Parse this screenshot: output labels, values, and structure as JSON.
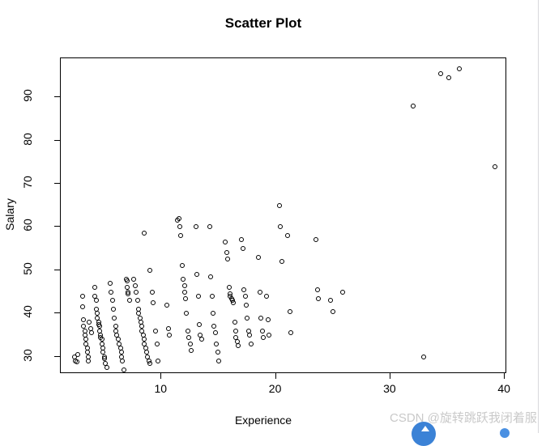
{
  "chart_data": {
    "type": "scatter",
    "title": "Scatter Plot",
    "xlabel": "Experience",
    "ylabel": "Salary",
    "xlim": [
      1.2,
      40.2
    ],
    "ylim": [
      26.0,
      99.0
    ],
    "xticks": [
      10,
      20,
      30,
      40
    ],
    "yticks": [
      30,
      40,
      50,
      60,
      70,
      80,
      90
    ],
    "grid": false,
    "legend": null,
    "marker": "open-circle",
    "marker_color": "#000000",
    "points": [
      [
        2.4,
        30.0
      ],
      [
        2.5,
        29.0
      ],
      [
        2.6,
        28.8
      ],
      [
        2.7,
        30.5
      ],
      [
        3.1,
        44.0
      ],
      [
        3.1,
        41.5
      ],
      [
        3.2,
        38.5
      ],
      [
        3.2,
        37.0
      ],
      [
        3.3,
        36.0
      ],
      [
        3.3,
        35.0
      ],
      [
        3.4,
        34.0
      ],
      [
        3.4,
        33.0
      ],
      [
        3.5,
        32.0
      ],
      [
        3.5,
        31.0
      ],
      [
        3.6,
        30.0
      ],
      [
        3.6,
        29.0
      ],
      [
        3.7,
        38.0
      ],
      [
        3.8,
        36.5
      ],
      [
        3.9,
        35.5
      ],
      [
        4.2,
        46.0
      ],
      [
        4.2,
        44.0
      ],
      [
        4.3,
        43.0
      ],
      [
        4.3,
        41.0
      ],
      [
        4.4,
        40.0
      ],
      [
        4.4,
        39.0
      ],
      [
        4.5,
        38.0
      ],
      [
        4.5,
        37.5
      ],
      [
        4.6,
        37.0
      ],
      [
        4.6,
        36.0
      ],
      [
        4.7,
        35.0
      ],
      [
        4.7,
        34.5
      ],
      [
        4.8,
        34.0
      ],
      [
        4.8,
        33.0
      ],
      [
        4.9,
        32.0
      ],
      [
        4.9,
        31.0
      ],
      [
        5.0,
        30.0
      ],
      [
        5.0,
        29.5
      ],
      [
        5.1,
        28.5
      ],
      [
        5.2,
        27.5
      ],
      [
        5.5,
        47.0
      ],
      [
        5.6,
        45.0
      ],
      [
        5.7,
        43.0
      ],
      [
        5.8,
        41.0
      ],
      [
        5.9,
        39.0
      ],
      [
        6.0,
        37.0
      ],
      [
        6.0,
        36.0
      ],
      [
        6.1,
        35.0
      ],
      [
        6.2,
        34.0
      ],
      [
        6.3,
        33.0
      ],
      [
        6.4,
        32.0
      ],
      [
        6.5,
        31.0
      ],
      [
        6.5,
        30.0
      ],
      [
        6.6,
        29.0
      ],
      [
        6.7,
        27.0
      ],
      [
        6.9,
        48.0
      ],
      [
        7.0,
        47.5
      ],
      [
        7.0,
        46.0
      ],
      [
        7.1,
        45.0
      ],
      [
        7.1,
        44.5
      ],
      [
        7.2,
        43.0
      ],
      [
        7.6,
        48.0
      ],
      [
        7.7,
        46.5
      ],
      [
        7.8,
        45.0
      ],
      [
        7.9,
        43.0
      ],
      [
        8.0,
        41.0
      ],
      [
        8.0,
        40.0
      ],
      [
        8.1,
        39.0
      ],
      [
        8.2,
        38.0
      ],
      [
        8.3,
        37.0
      ],
      [
        8.3,
        36.0
      ],
      [
        8.4,
        35.0
      ],
      [
        8.5,
        34.0
      ],
      [
        8.5,
        33.0
      ],
      [
        8.6,
        32.0
      ],
      [
        8.7,
        31.0
      ],
      [
        8.8,
        30.0
      ],
      [
        8.9,
        29.0
      ],
      [
        9.0,
        28.5
      ],
      [
        8.5,
        58.5
      ],
      [
        9.0,
        50.0
      ],
      [
        9.2,
        45.0
      ],
      [
        9.3,
        42.5
      ],
      [
        9.5,
        36.0
      ],
      [
        9.6,
        33.0
      ],
      [
        9.7,
        29.0
      ],
      [
        10.5,
        42.0
      ],
      [
        10.6,
        36.5
      ],
      [
        10.7,
        35.0
      ],
      [
        11.4,
        61.5
      ],
      [
        11.5,
        62.0
      ],
      [
        11.6,
        60.0
      ],
      [
        11.7,
        58.0
      ],
      [
        11.8,
        51.0
      ],
      [
        11.9,
        48.0
      ],
      [
        12.0,
        46.5
      ],
      [
        12.0,
        45.0
      ],
      [
        12.1,
        43.5
      ],
      [
        12.2,
        40.0
      ],
      [
        12.3,
        36.0
      ],
      [
        12.4,
        34.5
      ],
      [
        12.5,
        33.0
      ],
      [
        12.6,
        31.5
      ],
      [
        13.0,
        60.0
      ],
      [
        13.1,
        49.0
      ],
      [
        13.2,
        44.0
      ],
      [
        13.3,
        37.5
      ],
      [
        13.4,
        35.0
      ],
      [
        13.5,
        34.0
      ],
      [
        14.2,
        60.0
      ],
      [
        14.3,
        48.5
      ],
      [
        14.4,
        44.0
      ],
      [
        14.5,
        40.0
      ],
      [
        14.6,
        37.0
      ],
      [
        14.7,
        35.5
      ],
      [
        14.8,
        33.0
      ],
      [
        14.9,
        31.0
      ],
      [
        15.0,
        29.0
      ],
      [
        15.6,
        56.5
      ],
      [
        15.7,
        54.0
      ],
      [
        15.8,
        52.5
      ],
      [
        15.9,
        46.0
      ],
      [
        16.0,
        44.5
      ],
      [
        16.0,
        44.0
      ],
      [
        16.1,
        43.5
      ],
      [
        16.2,
        43.0
      ],
      [
        16.3,
        42.5
      ],
      [
        16.4,
        38.0
      ],
      [
        16.5,
        36.0
      ],
      [
        16.5,
        34.5
      ],
      [
        16.6,
        33.5
      ],
      [
        16.7,
        32.5
      ],
      [
        17.0,
        57.0
      ],
      [
        17.1,
        55.0
      ],
      [
        17.2,
        45.5
      ],
      [
        17.3,
        44.0
      ],
      [
        17.4,
        42.0
      ],
      [
        17.5,
        39.0
      ],
      [
        17.6,
        36.0
      ],
      [
        17.7,
        35.0
      ],
      [
        17.8,
        33.0
      ],
      [
        18.5,
        53.0
      ],
      [
        18.6,
        45.0
      ],
      [
        18.7,
        39.0
      ],
      [
        18.8,
        36.0
      ],
      [
        18.9,
        34.5
      ],
      [
        19.2,
        44.0
      ],
      [
        19.3,
        38.5
      ],
      [
        19.4,
        35.0
      ],
      [
        20.3,
        65.0
      ],
      [
        20.4,
        60.0
      ],
      [
        20.5,
        52.0
      ],
      [
        21.0,
        58.0
      ],
      [
        21.2,
        40.5
      ],
      [
        21.3,
        35.5
      ],
      [
        23.5,
        57.0
      ],
      [
        23.6,
        45.5
      ],
      [
        23.7,
        43.5
      ],
      [
        24.8,
        43.0
      ],
      [
        25.0,
        40.5
      ],
      [
        25.8,
        45.0
      ],
      [
        32.0,
        88.0
      ],
      [
        32.9,
        30.0
      ],
      [
        34.4,
        95.5
      ],
      [
        35.1,
        94.5
      ],
      [
        36.0,
        96.5
      ],
      [
        39.1,
        74.0
      ]
    ]
  },
  "watermark": {
    "text": "CSDN @旋转跳跃我闭着服",
    "badge_icon": "up-arrow-icon",
    "badge_color": "#3b82d6",
    "dot_color": "#4a90e2"
  }
}
